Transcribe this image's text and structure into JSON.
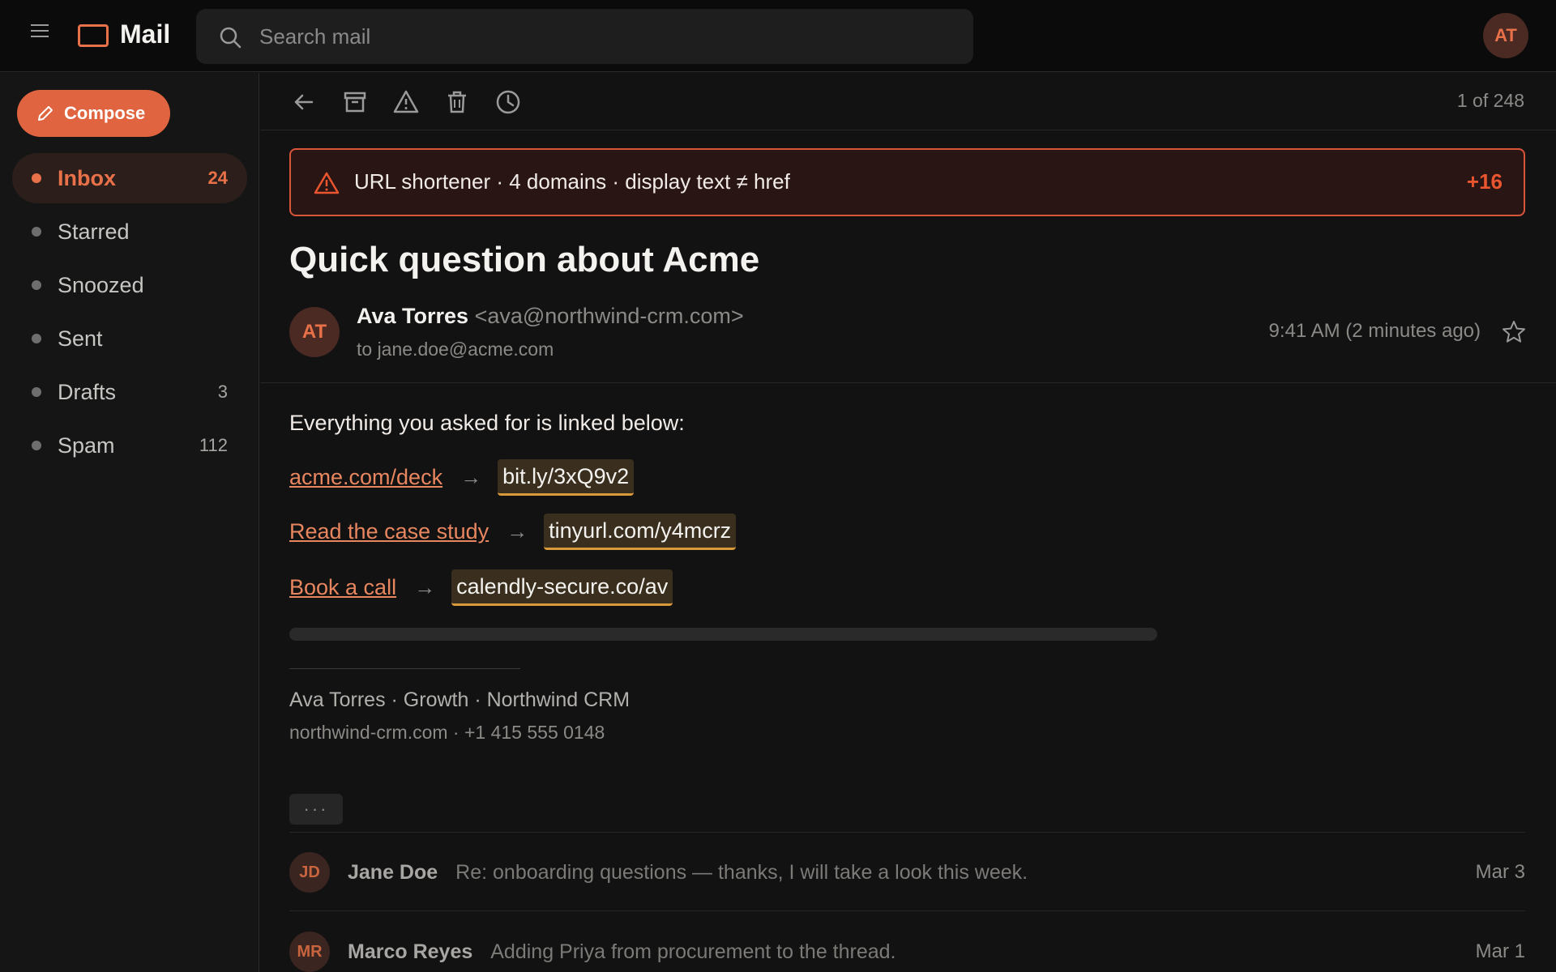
{
  "app": {
    "name": "Mail",
    "user_initials": "AT"
  },
  "search": {
    "placeholder": "Search mail"
  },
  "compose": {
    "label": "Compose"
  },
  "nav": [
    {
      "label": "Inbox",
      "count": "24",
      "active": true
    },
    {
      "label": "Starred",
      "count": ""
    },
    {
      "label": "Snoozed",
      "count": ""
    },
    {
      "label": "Sent",
      "count": ""
    },
    {
      "label": "Drafts",
      "count": "3"
    },
    {
      "label": "Spam",
      "count": "112"
    }
  ],
  "toolbar": {
    "icons": [
      "back-icon",
      "archive-icon",
      "report-spam-icon",
      "delete-icon",
      "snooze-icon"
    ],
    "pager": "1 of 248"
  },
  "warning": {
    "text": "URL shortener · 4 domains · display text ≠ href",
    "score": "+16"
  },
  "message": {
    "subject": "Quick question about Acme",
    "sender_initials": "AT",
    "sender_name": "Ava Torres",
    "sender_email": "<ava@northwind-crm.com>",
    "to": "to jane.doe@acme.com",
    "time": "9:41 AM (2 minutes ago)",
    "intro": "Everything you asked for is linked below:",
    "links": [
      {
        "text": "acme.com/deck",
        "arrow": "→",
        "target": "bit.ly/3xQ9v2"
      },
      {
        "text": "Read the case study",
        "arrow": "→",
        "target": "tinyurl.com/y4mcrz"
      },
      {
        "text": "Book a call",
        "arrow": "→",
        "target": "calendly-secure.co/av"
      }
    ],
    "signature_line1": "Ava Torres · Growth · Northwind CRM",
    "signature_line2": "northwind-crm.com · +1 415 555 0148",
    "more_label": "···"
  },
  "thread": [
    {
      "initials": "JD",
      "name": "Jane Doe",
      "snippet": "Re: onboarding questions — thanks, I will take a look this week.",
      "date": "Mar 3"
    },
    {
      "initials": "MR",
      "name": "Marco Reyes",
      "snippet": "Adding Priya from procurement to the thread.",
      "date": "Mar 1"
    }
  ],
  "colors": {
    "accent": "#e8714a",
    "warning": "#d9553a",
    "background": "#121212"
  }
}
